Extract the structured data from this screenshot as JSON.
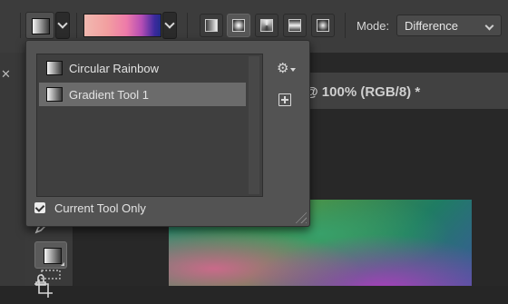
{
  "options_bar": {
    "mode_label": "Mode:",
    "mode_value": "Difference",
    "gradient_colors": [
      "#f1b9b0",
      "#ee7ba9",
      "#b64eb5",
      "#222c8c"
    ],
    "gradient_types": [
      "linear",
      "radial",
      "angle",
      "reflected",
      "diamond"
    ],
    "active_gradient_type": "radial"
  },
  "document": {
    "tab_title": "@ 100% (RGB/8) *"
  },
  "preset_picker": {
    "items": [
      {
        "label": "Circular Rainbow",
        "selected": false
      },
      {
        "label": "Gradient Tool 1",
        "selected": true
      }
    ],
    "current_tool_only_label": "Current Tool Only",
    "current_tool_only_checked": true
  },
  "tools": [
    "move-icon",
    "triangle-shape-icon",
    "pen-icon",
    "freeform-pen-icon",
    "eyedropper-icon",
    "healing-brush-icon",
    "marquee-icon",
    "gradient-icon",
    "crop-icon",
    "stamp-icon"
  ],
  "colors": {
    "panel_bg": "#535353",
    "list_bg": "#3f3f3f",
    "selection": "#6b6b6b",
    "options_bar": "#3c3c3c"
  }
}
